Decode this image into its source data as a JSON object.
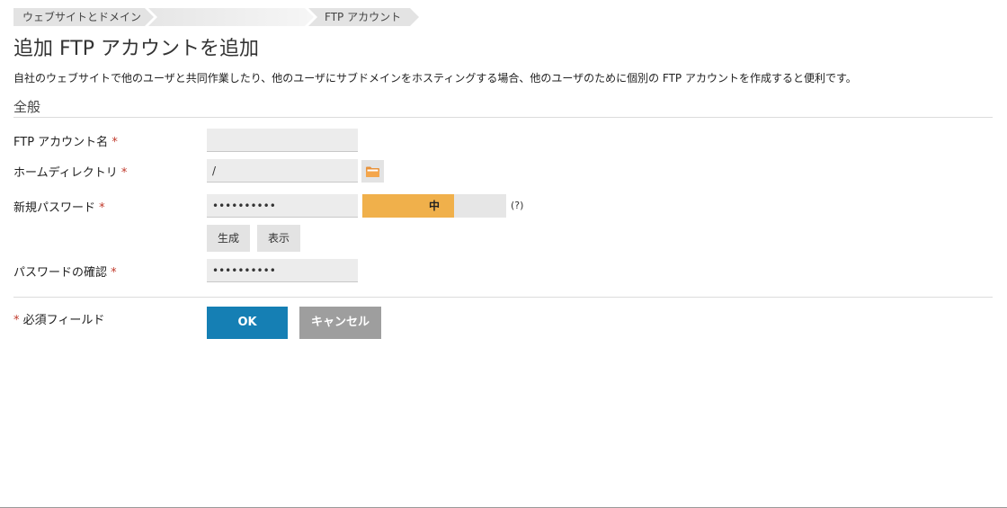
{
  "breadcrumb": {
    "items": [
      "ウェブサイトとドメイン",
      "",
      "FTP アカウント"
    ]
  },
  "page": {
    "title": "追加 FTP アカウントを追加",
    "description": "自社のウェブサイトで他のユーザと共同作業したり、他のユーザにサブドメインをホスティングする場合、他のユーザのために個別の FTP アカウントを作成すると便利です。",
    "section_title": "全般"
  },
  "form": {
    "ftp_account_name": {
      "label": "FTP アカウント名",
      "required_mark": "*",
      "value": ""
    },
    "home_directory": {
      "label": "ホームディレクトリ",
      "required_mark": "*",
      "value": "/"
    },
    "new_password": {
      "label": "新規パスワード",
      "required_mark": "*",
      "value": "••••••••••",
      "strength_label": "中",
      "strength_fraction": 0.64,
      "strength_color": "#f0b04b",
      "help_text": "(?)",
      "generate_label": "生成",
      "show_label": "表示"
    },
    "confirm_password": {
      "label": "パスワードの確認",
      "required_mark": "*",
      "value": "••••••••••"
    }
  },
  "footer": {
    "required_note_mark": "*",
    "required_note": "必須フィールド",
    "ok_label": "OK",
    "cancel_label": "キャンセル"
  },
  "colors": {
    "primary": "#157fb4",
    "secondary": "#9e9e9e",
    "required": "#c0392b"
  },
  "icons": {
    "browse": "folder-icon"
  }
}
